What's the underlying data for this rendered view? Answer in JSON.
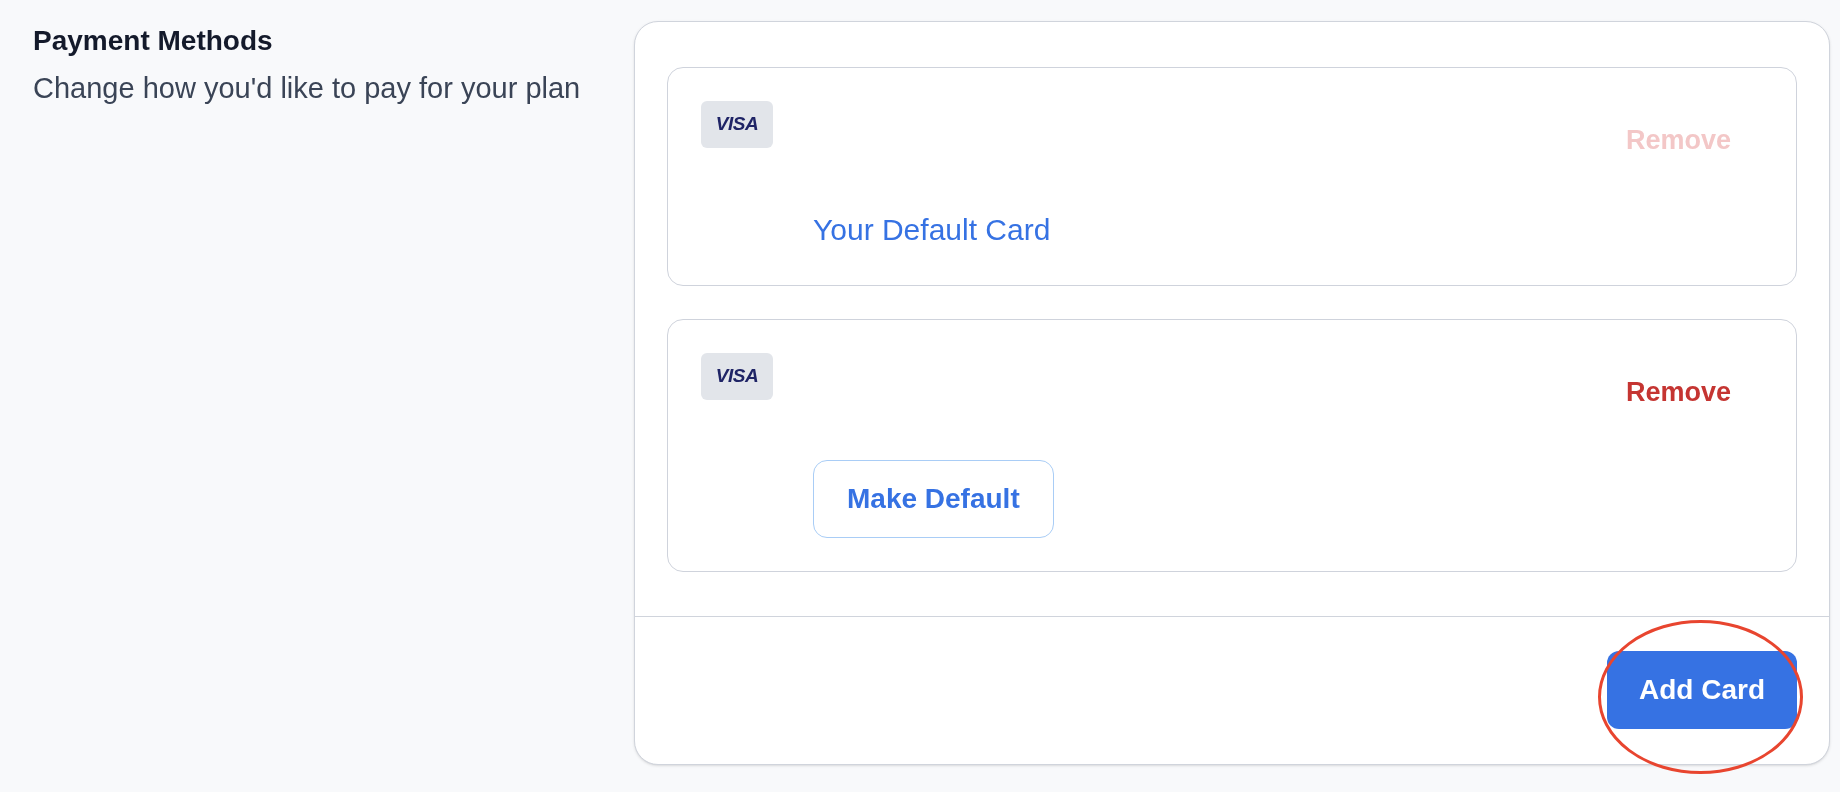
{
  "section": {
    "title": "Payment Methods",
    "description": "Change how you'd like to pay for your plan"
  },
  "cards": [
    {
      "brand": "VISA",
      "remove": {
        "label": "Remove",
        "disabled": true
      },
      "status": {
        "kind": "label",
        "text": "Your Default Card"
      }
    },
    {
      "brand": "VISA",
      "remove": {
        "label": "Remove",
        "disabled": false
      },
      "status": {
        "kind": "button",
        "text": "Make Default"
      }
    }
  ],
  "add_button": {
    "label": "Add Card",
    "highlighted": true
  }
}
